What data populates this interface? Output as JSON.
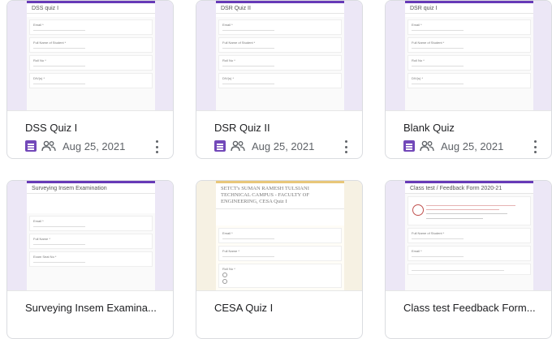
{
  "cards": [
    {
      "title": "DSS Quiz I",
      "date": "Aug 25, 2021",
      "preview": {
        "form_title": "DSS quiz I",
        "questions": [
          "Email *",
          "Full Name of Student *",
          "Roll No *",
          "DIV(s) *"
        ]
      }
    },
    {
      "title": "DSR Quiz II",
      "date": "Aug 25, 2021",
      "preview": {
        "form_title": "DSR Quiz II",
        "questions": [
          "Email *",
          "Full Name of Student *",
          "Roll No *",
          "DIV(s) *"
        ]
      }
    },
    {
      "title": "Blank Quiz",
      "date": "Aug 25, 2021",
      "preview": {
        "form_title": "DSR quiz I",
        "questions": [
          "Email *",
          "Full Name of Student *",
          "Roll No *",
          "DIV(s) *"
        ]
      }
    },
    {
      "title": "Surveying Insem Examina...",
      "preview": {
        "form_title": "Surveying Insem Examination",
        "questions": [
          "Email *",
          "Full Name *",
          "Exam Seat No *"
        ]
      }
    },
    {
      "title": "CESA Quiz I",
      "preview": {
        "form_title": "SETCT's SUMAN RAMESH TULSIANI TECHNICAL CAMPUS - FACULTY OF ENGINEERING, CESA Quiz I",
        "questions": [
          "Email *",
          "Full Name *",
          "Roll No *"
        ]
      }
    },
    {
      "title": "Class test Feedback Form...",
      "preview": {
        "form_title": "Class test / Feedback Form 2020-21",
        "questions": [
          "Full Name of Student *",
          "Email *"
        ]
      }
    }
  ],
  "icons": {
    "form": "google-forms-icon",
    "shared": "people-icon",
    "menu": "more-vert-icon"
  },
  "colors": {
    "forms_purple": "#7248b9",
    "header_accent": "#673ab7"
  }
}
